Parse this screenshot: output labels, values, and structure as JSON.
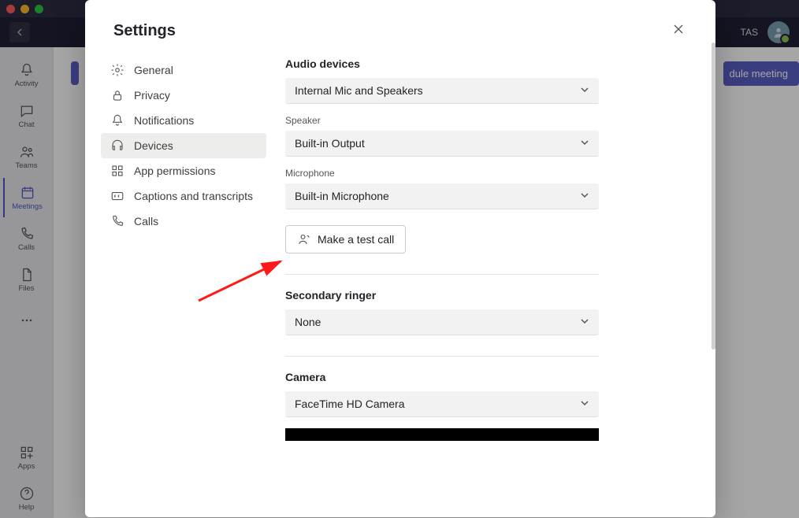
{
  "topbar": {
    "user_initials": "TAS",
    "avatar_glyph": "☺"
  },
  "sidebar": {
    "items": [
      {
        "label": "Activity"
      },
      {
        "label": "Chat"
      },
      {
        "label": "Teams"
      },
      {
        "label": "Meetings"
      },
      {
        "label": "Calls"
      },
      {
        "label": "Files"
      }
    ],
    "bottom": [
      {
        "label": "Apps"
      },
      {
        "label": "Help"
      }
    ]
  },
  "main": {
    "schedule_btn": "dule meeting"
  },
  "modal": {
    "title": "Settings",
    "nav": [
      {
        "label": "General"
      },
      {
        "label": "Privacy"
      },
      {
        "label": "Notifications"
      },
      {
        "label": "Devices"
      },
      {
        "label": "App permissions"
      },
      {
        "label": "Captions and transcripts"
      },
      {
        "label": "Calls"
      }
    ],
    "content": {
      "audio_devices_heading": "Audio devices",
      "audio_device_value": "Internal Mic and Speakers",
      "speaker_label": "Speaker",
      "speaker_value": "Built-in Output",
      "microphone_label": "Microphone",
      "microphone_value": "Built-in Microphone",
      "test_call_label": "Make a test call",
      "secondary_ringer_heading": "Secondary ringer",
      "secondary_ringer_value": "None",
      "camera_heading": "Camera",
      "camera_value": "FaceTime HD Camera"
    }
  }
}
